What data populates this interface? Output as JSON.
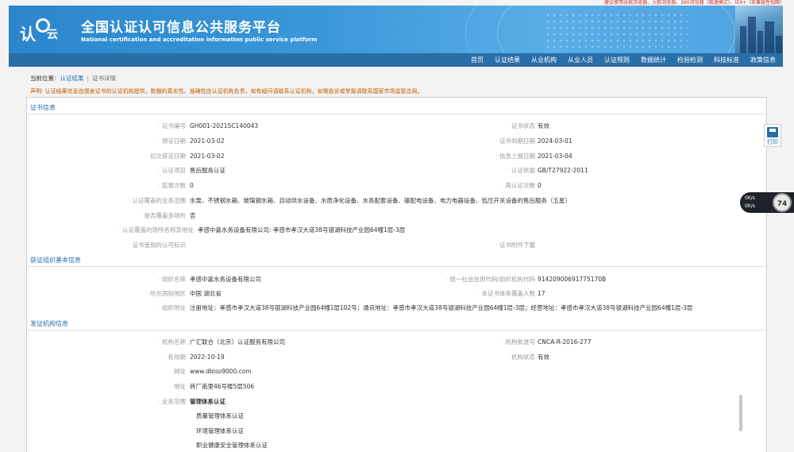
{
  "top_notice": "建议使用谷歌浏览器、火狐浏览器、360浏览器（极速模式）、IE9+（非兼容性视图）",
  "header": {
    "logo_text_1": "认",
    "logo_text_2": "云",
    "title": "全国认证认可信息公共服务平台",
    "subtitle": "National certification and accreditation information public service platform"
  },
  "nav": {
    "items": [
      "首页",
      "认证结果",
      "从业机构",
      "从业人员",
      "认证规则",
      "数据统计",
      "检验检测",
      "科技标准",
      "政策信息"
    ]
  },
  "breadcrumb": {
    "prefix": "当前位置：",
    "link": "认证结果",
    "sep": "|",
    "current": "证书详情"
  },
  "declaration": "声明: 认证结果信息由颁发证书的认证机构提供，数据的真实性、准确性由认证机构负责，如有疑问请联系认证机构，如需投诉或举报请联系国家市场监管总局。",
  "cert_section": {
    "title": "证书信息",
    "rows": [
      {
        "l1": "证书编号",
        "v1": "GH001-2021SC140043",
        "l2": "证书状态",
        "v2": "有效"
      },
      {
        "l1": "颁证日期",
        "v1": "2021-03-02",
        "l2": "证书到期日期",
        "v2": "2024-03-01"
      },
      {
        "l1": "初次获证日期",
        "v1": "2021-03-02",
        "l2": "信息上报日期",
        "v2": "2021-03-04"
      },
      {
        "l1": "认证项目",
        "v1": "售后服务认证",
        "l2": "认证依据",
        "v2": "GB/T27922-2011"
      },
      {
        "l1": "监督次数",
        "v1": "0",
        "l2": "再认证次数",
        "v2": "0"
      }
    ],
    "scope_label": "认证覆盖的业务范围",
    "scope_value": "水泵、不锈钢水箱、玻璃钢水箱、自动供水设备、水质净化设备、水务配套设备、输配电设备、电力电器设备、低压开关设备的售后服务（五星）",
    "multi_site_label": "是否覆盖多场所",
    "multi_site_value": "否",
    "site_label": "认证覆盖的场所名称及地址",
    "site_value": "孝感中嘉水务设备有限公司: 孝感市孝汉大道38号银湖科技产业园64幢1层-3层",
    "mark_label": "证书使用的认可标识",
    "attach_label": "证书附件下载"
  },
  "org_section": {
    "title": "获证组织基本信息",
    "name_label": "组织名称",
    "name_value": "孝感中嘉水务设备有限公司",
    "credit_label": "统一社会信用代码/组织机构代码",
    "credit_value": "91420900691775170B",
    "region_label": "所在国别地区",
    "region_value": "中国 湖北省",
    "people_label": "本证书体系覆盖人数",
    "people_value": "17",
    "address_label": "组织地址",
    "address_value": "注册地址：孝感市孝汉大道38号银湖科技产业园64幢1层102号；通讯地址：孝感市孝汉大道38号银湖科技产业园64幢1层-3层；经营地址：孝感市孝汉大道38号银湖科技产业园64幢1层-3层"
  },
  "issuer_section": {
    "title": "发证机构信息",
    "name_label": "机构名称",
    "name_value": "广汇联合（北京）认证服务有限公司",
    "approval_label": "机构批准号",
    "approval_value": "CNCA-R-2016-277",
    "valid_label": "有效期",
    "valid_value": "2022-10-19",
    "status_label": "机构状态",
    "status_value": "有效",
    "site_label": "网址",
    "site_value": "www.dbiso9000.com",
    "addr_label": "地址",
    "addr_value": "砖厂南里46号楼5层506",
    "biz_label": "业务范围",
    "biz_head": "管理体系认证",
    "biz_items": [
      "质量管理体系认证",
      "环境管理体系认证",
      "职业健康安全管理体系认证"
    ]
  },
  "print_label": "打印",
  "speed_widget": {
    "up": "0K/s",
    "down": "0K/s",
    "percent": "74"
  }
}
